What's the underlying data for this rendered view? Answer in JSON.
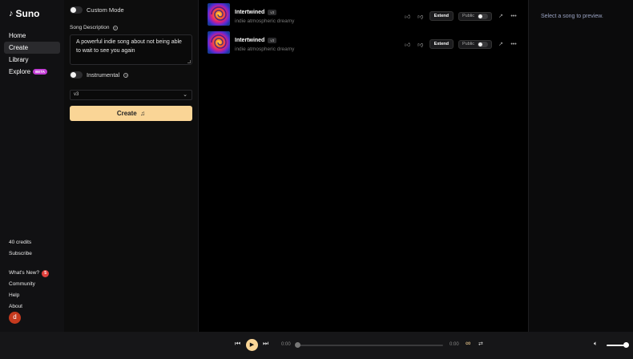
{
  "app": {
    "name": "Suno",
    "logo_icon": "music-note-icon"
  },
  "sidebar": {
    "nav": [
      {
        "label": "Home",
        "active": false
      },
      {
        "label": "Create",
        "active": true
      },
      {
        "label": "Library",
        "active": false
      },
      {
        "label": "Explore",
        "active": false,
        "badge": "BETA"
      }
    ],
    "credits": "40 credits",
    "subscribe": "Subscribe",
    "links": [
      {
        "label": "What's New?",
        "badge": "5"
      },
      {
        "label": "Community"
      },
      {
        "label": "Help"
      },
      {
        "label": "About"
      }
    ],
    "avatar_initial": "d"
  },
  "create": {
    "custom_mode_label": "Custom Mode",
    "custom_mode_on": false,
    "description_label": "Song Description",
    "description_value": "A powerful indie song about not being able to wait to see you again",
    "instrumental_label": "Instrumental",
    "instrumental_on": false,
    "model_select": "v3",
    "create_button": "Create"
  },
  "songs": [
    {
      "title": "Intertwined",
      "version": "v3",
      "tags": "indie atmospheric dreamy",
      "extend_label": "Extend",
      "public_label": "Public",
      "public_on": false
    },
    {
      "title": "Intertwined",
      "version": "v3",
      "tags": "indie atmospheric dreamy",
      "extend_label": "Extend",
      "public_label": "Public",
      "public_on": false
    }
  ],
  "preview": {
    "placeholder": "Select a song to preview."
  },
  "player": {
    "current_time": "0:00",
    "duration": "0:00",
    "progress": 0,
    "volume": 1.0
  },
  "colors": {
    "accent": "#fad596",
    "beta_badge": "#c43fd6",
    "notification_badge": "#e0403c",
    "avatar": "#c63a1e"
  }
}
